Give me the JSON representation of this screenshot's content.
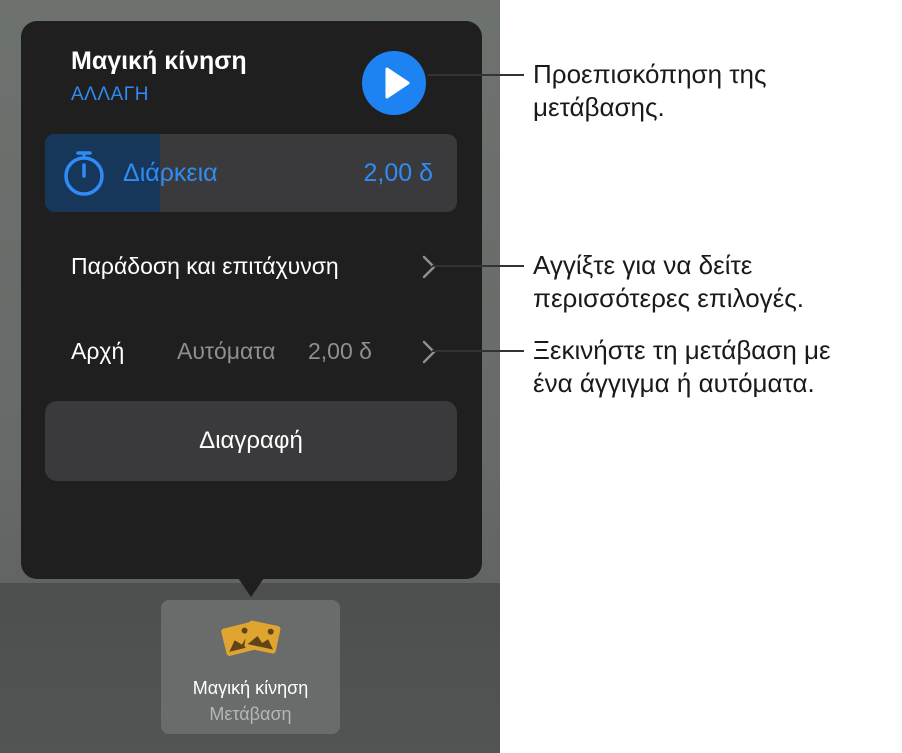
{
  "popover": {
    "title": "Μαγική κίνηση",
    "change_label": "ΑΛΛΑΓΗ",
    "duration": {
      "label": "Διάρκεια",
      "value": "2,00 δ",
      "slider_fraction": 0.28
    },
    "ease_row": {
      "label": "Παράδοση και επιτάχυνση"
    },
    "start_row": {
      "label": "Αρχή",
      "mode": "Αυτόματα",
      "value": "2,00 δ"
    },
    "delete_label": "Διαγραφή"
  },
  "thumbnail": {
    "title": "Μαγική κίνηση",
    "subtitle": "Μετάβαση",
    "icon": "photos-icon"
  },
  "callouts": {
    "preview": [
      "Προεπισκόπηση της",
      "μετάβασης."
    ],
    "more_options": [
      "Αγγίξτε για να δείτε",
      "περισσότερες επιλογές."
    ],
    "start": [
      "Ξεκινήστε τη μετάβαση με",
      "ένα άγγιγμα ή αυτόματα."
    ]
  },
  "colors": {
    "accent": "#1e83f2",
    "popover_bg": "#1f1f1f",
    "row_bg": "#3a3a3c",
    "slider_fill": "#17375a",
    "icon_yellow": "#e0a530"
  },
  "icons": [
    "play-icon",
    "timer-icon",
    "chevron-right-icon",
    "photos-icon"
  ]
}
